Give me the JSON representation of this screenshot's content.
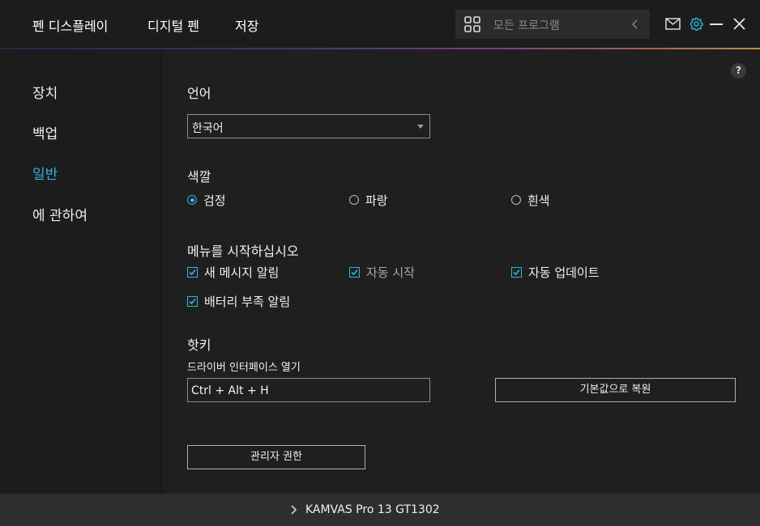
{
  "top_nav": {
    "tabs": [
      "펜 디스플레이",
      "디지털 펜",
      "저장"
    ],
    "search_placeholder": "모든 프로그램",
    "icons": [
      "apps-grid-icon",
      "chevron-left-icon",
      "mail-icon",
      "gear-icon",
      "minimize-icon",
      "close-icon"
    ],
    "accent_color": "#2fb6e5"
  },
  "sidebar": {
    "items": [
      {
        "label": "장치",
        "active": false
      },
      {
        "label": "백업",
        "active": false
      },
      {
        "label": "일반",
        "active": true
      },
      {
        "label": "에 관하여",
        "active": false
      }
    ]
  },
  "help_label": "?",
  "language": {
    "title": "언어",
    "selected": "한국어"
  },
  "color": {
    "title": "색깔",
    "options": [
      {
        "label": "검정",
        "selected": true
      },
      {
        "label": "파랑",
        "selected": false
      },
      {
        "label": "흰색",
        "selected": false
      }
    ]
  },
  "startup": {
    "title": "메뉴를 시작하십시오",
    "options": [
      {
        "label": "새 메시지 알림",
        "checked": true,
        "enabled": true
      },
      {
        "label": "자동 시작",
        "checked": true,
        "enabled": false
      },
      {
        "label": "자동 업데이트",
        "checked": true,
        "enabled": true
      },
      {
        "label": "배터리 부족 알림",
        "checked": true,
        "enabled": true
      }
    ]
  },
  "hotkey": {
    "title": "핫키",
    "label": "드라이버 인터페이스  열기",
    "value": "Ctrl + Alt + H",
    "restore_button": "기본값으로 복원"
  },
  "admin_button": "관리자 권한",
  "footer": {
    "device": "KAMVAS Pro 13 GT1302"
  }
}
